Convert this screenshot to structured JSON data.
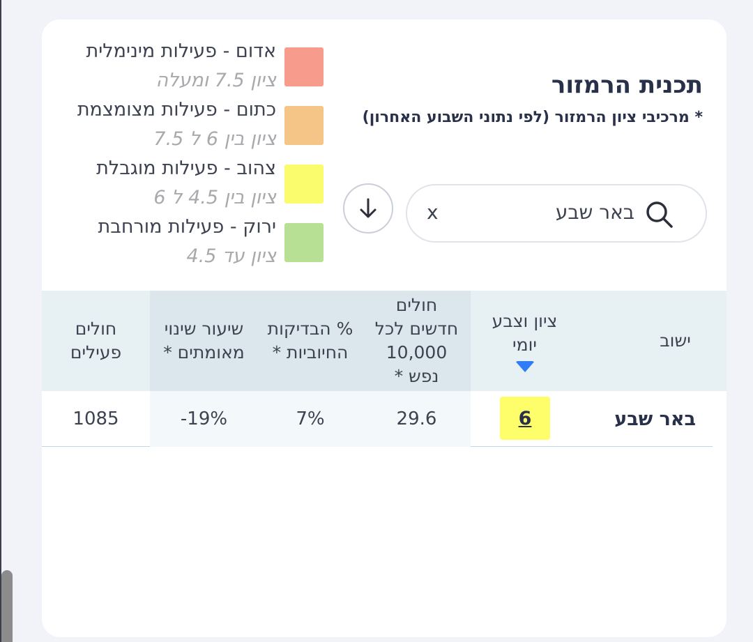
{
  "header": {
    "title": "תכנית הרמזור",
    "subtitle": "* מרכיבי ציון הרמזור (לפי נתוני השבוע האחרון)"
  },
  "legend": [
    {
      "label": "אדום - פעילות מינימלית",
      "range": "ציון 7.5 ומעלה",
      "color": "#f79b8d"
    },
    {
      "label": "כתום - פעילות מצומצמת",
      "range": "ציון בין 6 ל 7.5",
      "color": "#f4c586"
    },
    {
      "label": "צהוב - פעילות מוגבלת",
      "range": "ציון בין 4.5 ל 6",
      "color": "#fbfb6e"
    },
    {
      "label": "ירוק - פעילות מורחבת",
      "range": "ציון עד 4.5",
      "color": "#b8e095"
    }
  ],
  "search": {
    "value": "באר שבע",
    "clear_label": "x",
    "icon": "search-icon"
  },
  "download": {
    "icon": "arrow-down-icon"
  },
  "table": {
    "headers": {
      "city": "ישוב",
      "score": [
        "ציון וצבע",
        "יומי"
      ],
      "new_cases": [
        "חולים",
        "חדשים לכל",
        "10,000",
        "נפש *"
      ],
      "positive_pct": [
        "% הבדיקות",
        "החיוביות *"
      ],
      "change_rate": [
        "שיעור שינוי",
        "מאומתים *"
      ],
      "active": [
        "חולים",
        "פעילים"
      ]
    },
    "rows": [
      {
        "city": "באר שבע",
        "score": "6",
        "score_color": "#fefe6a",
        "new_cases": "29.6",
        "positive_pct": "7%",
        "change_rate": "-19%",
        "active": "1085"
      }
    ]
  }
}
